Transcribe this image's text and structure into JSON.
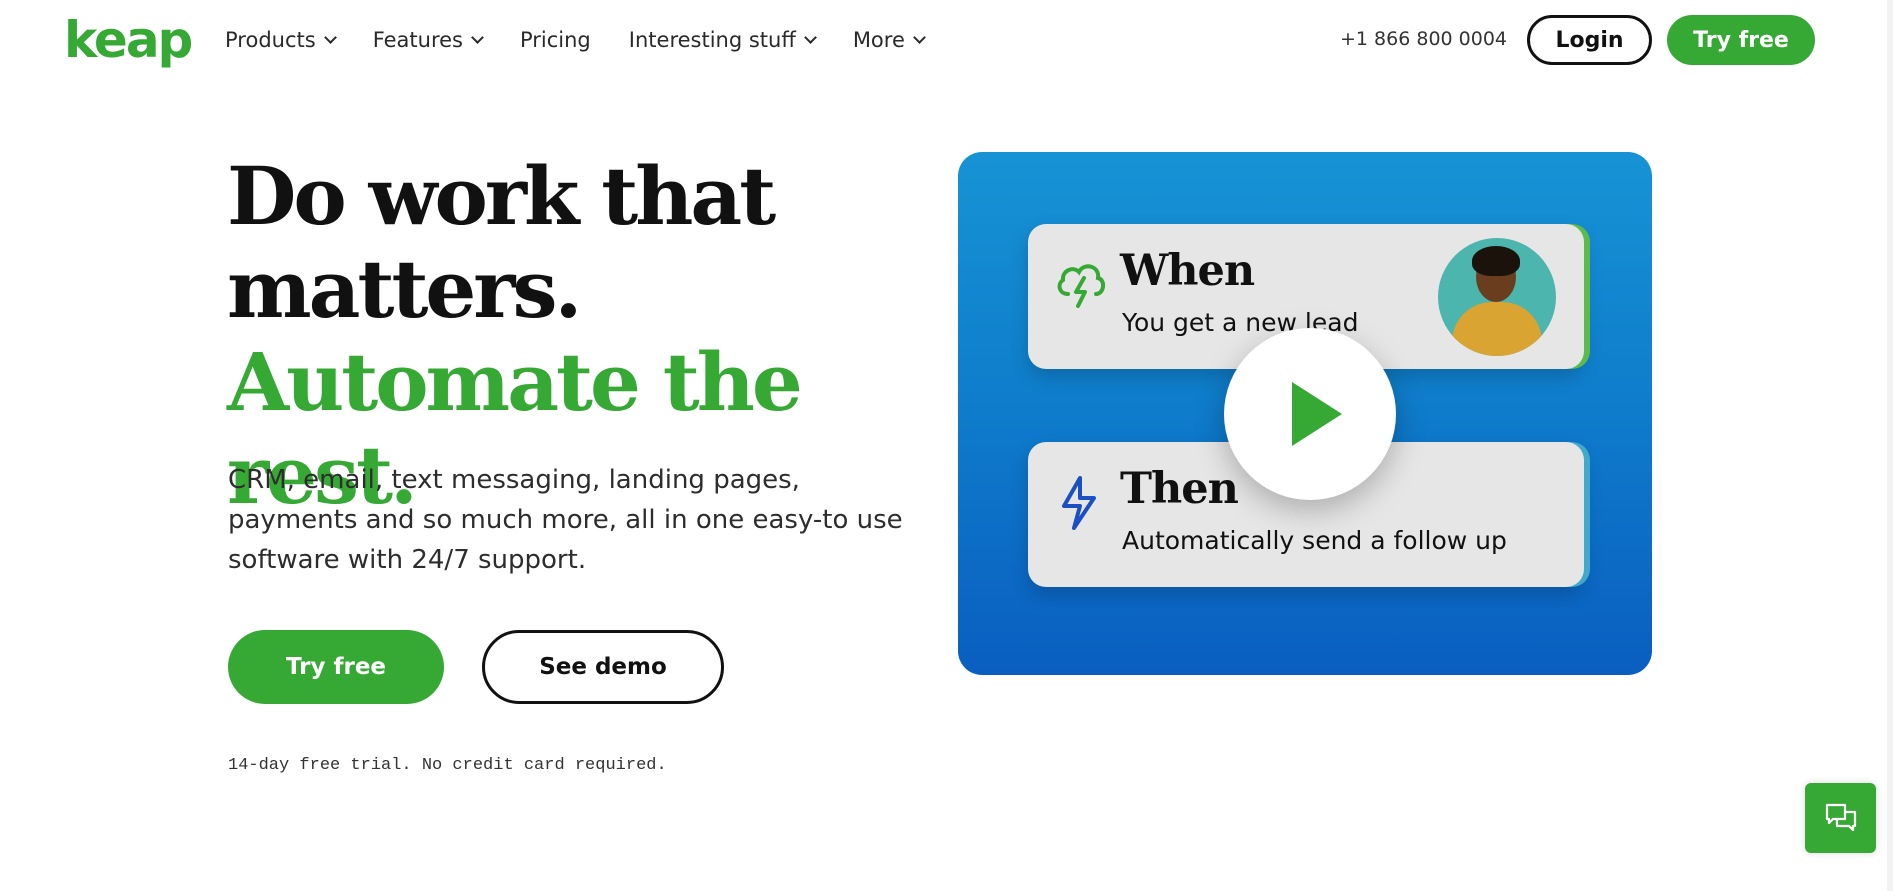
{
  "header": {
    "logo": "keap",
    "nav": [
      {
        "label": "Products",
        "has_dropdown": true
      },
      {
        "label": "Features",
        "has_dropdown": true
      },
      {
        "label": "Pricing",
        "has_dropdown": false
      },
      {
        "label": "Interesting stuff",
        "has_dropdown": true
      },
      {
        "label": "More",
        "has_dropdown": true
      }
    ],
    "phone": "+1 866 800 0004",
    "login_label": "Login",
    "try_free_label": "Try free"
  },
  "hero": {
    "headline_black": "Do work that matters.",
    "headline_green": "Automate the rest.",
    "subtext": "CRM, email, text messaging, landing pages, payments and so much more, all in one easy-to use software with 24/7 support.",
    "try_free_label": "Try free",
    "see_demo_label": "See demo",
    "trial_note": "14-day free trial. No credit card required."
  },
  "video": {
    "when_title": "When",
    "when_text": "You get a new lead",
    "then_title": "Then",
    "then_text": "Automatically send a follow up",
    "icons": {
      "when": "cloud-lightning-icon",
      "then": "lightning-icon",
      "play": "play-icon"
    }
  },
  "chat": {
    "icon": "chat-bubbles-icon"
  },
  "colors": {
    "brand_green": "#36a935",
    "video_blue": "#0f7ecc",
    "then_icon_blue": "#1b4fc4",
    "text_dark": "#111111"
  }
}
